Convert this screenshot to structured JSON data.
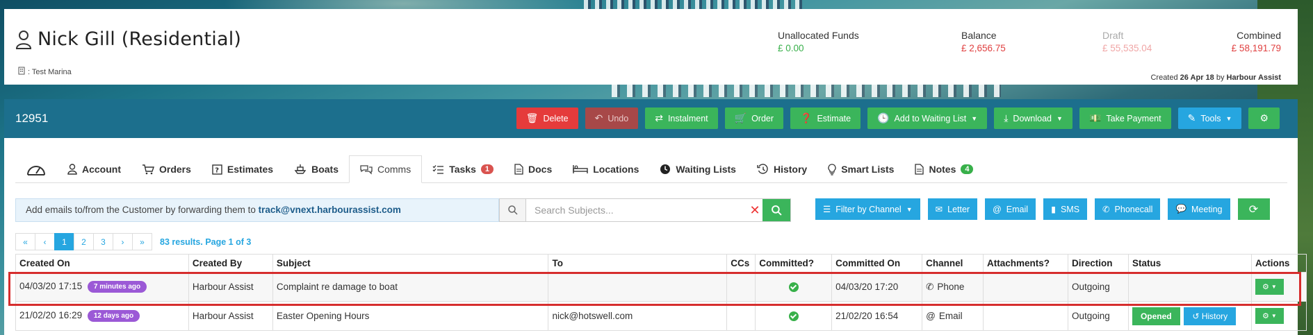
{
  "header": {
    "title": "Nick Gill (Residential)",
    "marina": ": Test Marina",
    "stats": {
      "unallocated": {
        "label": "Unallocated Funds",
        "value": "£ 0.00"
      },
      "balance": {
        "label": "Balance",
        "value": "£ 2,656.75"
      },
      "draft": {
        "label": "Draft",
        "value": "£ 55,535.04"
      },
      "combined": {
        "label": "Combined",
        "value": "£ 58,191.79"
      }
    },
    "created": {
      "prefix": "Created",
      "date": "26 Apr 18",
      "by_word": "by",
      "by": "Harbour Assist"
    }
  },
  "toolbar": {
    "record_id": "12951",
    "buttons": {
      "delete": "Delete",
      "undo": "Undo",
      "instalment": "Instalment",
      "order": "Order",
      "estimate": "Estimate",
      "waiting_list": "Add to Waiting List",
      "download": "Download",
      "take_payment": "Take Payment",
      "tools": "Tools"
    }
  },
  "tabs": {
    "account": "Account",
    "orders": "Orders",
    "estimates": "Estimates",
    "boats": "Boats",
    "comms": "Comms",
    "tasks": "Tasks",
    "tasks_badge": "1",
    "docs": "Docs",
    "locations": "Locations",
    "waiting_lists": "Waiting Lists",
    "history": "History",
    "smart_lists": "Smart Lists",
    "notes": "Notes",
    "notes_badge": "4"
  },
  "comms": {
    "info_text": "Add emails to/from the Customer by forwarding them to",
    "info_email": "track@vnext.harbourassist.com",
    "search_placeholder": "Search Subjects...",
    "filters": {
      "filter_by_channel": "Filter by Channel",
      "letter": "Letter",
      "email": "Email",
      "sms": "SMS",
      "phonecall": "Phonecall",
      "meeting": "Meeting"
    }
  },
  "pagination": {
    "first": "«",
    "prev": "‹",
    "pages": [
      "1",
      "2",
      "3"
    ],
    "next": "›",
    "last": "»",
    "info": "83 results. Page 1 of 3"
  },
  "table": {
    "columns": [
      "Created On",
      "Created By",
      "Subject",
      "To",
      "CCs",
      "Committed?",
      "Committed On",
      "Channel",
      "Attachments?",
      "Direction",
      "Status",
      "Actions"
    ],
    "rows": [
      {
        "created_on": "04/03/20 17:15",
        "ago": "7 minutes ago",
        "created_by": "Harbour Assist",
        "subject": "Complaint re damage to boat",
        "to": "",
        "ccs": "",
        "committed_on": "04/03/20 17:20",
        "channel": "Phone",
        "attachments": "",
        "direction": "Outgoing"
      },
      {
        "created_on": "21/02/20 16:29",
        "ago": "12 days ago",
        "created_by": "Harbour Assist",
        "subject": "Easter Opening Hours",
        "to": "nick@hotswell.com",
        "ccs": "",
        "committed_on": "21/02/20 16:54",
        "channel": "Email",
        "attachments": "",
        "direction": "Outgoing",
        "status_opened": "Opened",
        "status_history": "History"
      }
    ]
  },
  "colors": {
    "toolbar": "#1c6f8d",
    "green": "#3bb55b",
    "blue": "#26a6e0",
    "red": "#e53b3b",
    "purple": "#9b59d6"
  }
}
